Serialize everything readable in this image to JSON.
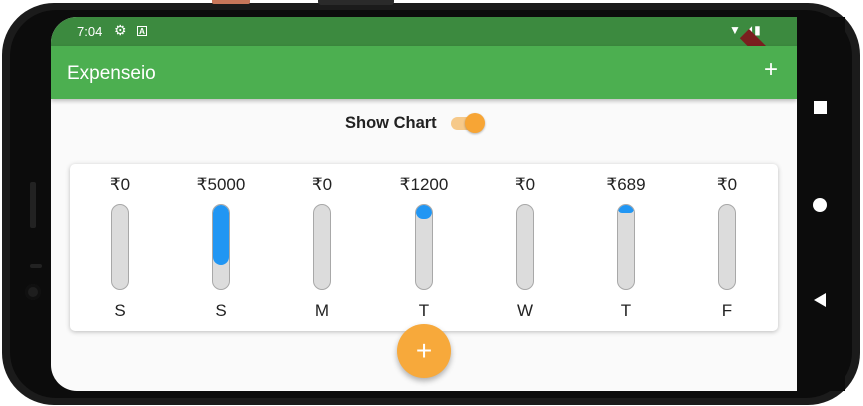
{
  "status_bar": {
    "time": "7:04",
    "left_icons": [
      "settings-icon",
      "a-icon"
    ],
    "right_icons": [
      "wifi-icon",
      "signal-icon",
      "battery-icon"
    ],
    "debug_banner": "DEBUG"
  },
  "app_bar": {
    "title": "Expenseio",
    "add_icon": "plus-icon",
    "background_color": "#4caf50"
  },
  "toggle": {
    "label": "Show Chart",
    "on": true,
    "accent_color": "#f7a535"
  },
  "chart": {
    "bar_color": "#2196f3",
    "track_color": "#dcdcdc",
    "bars": [
      {
        "day": "S",
        "amount": "₹0",
        "fill": 0
      },
      {
        "day": "S",
        "amount": "₹5000",
        "fill": 0.72
      },
      {
        "day": "M",
        "amount": "₹0",
        "fill": 0
      },
      {
        "day": "T",
        "amount": "₹1200",
        "fill": 0.17
      },
      {
        "day": "W",
        "amount": "₹0",
        "fill": 0
      },
      {
        "day": "T",
        "amount": "₹689",
        "fill": 0.1
      },
      {
        "day": "F",
        "amount": "₹0",
        "fill": 0
      }
    ]
  },
  "fab": {
    "icon": "plus-icon",
    "color": "#f7a93b"
  },
  "nav_bar": {
    "icons": [
      "recents-icon",
      "home-icon",
      "back-icon"
    ]
  }
}
